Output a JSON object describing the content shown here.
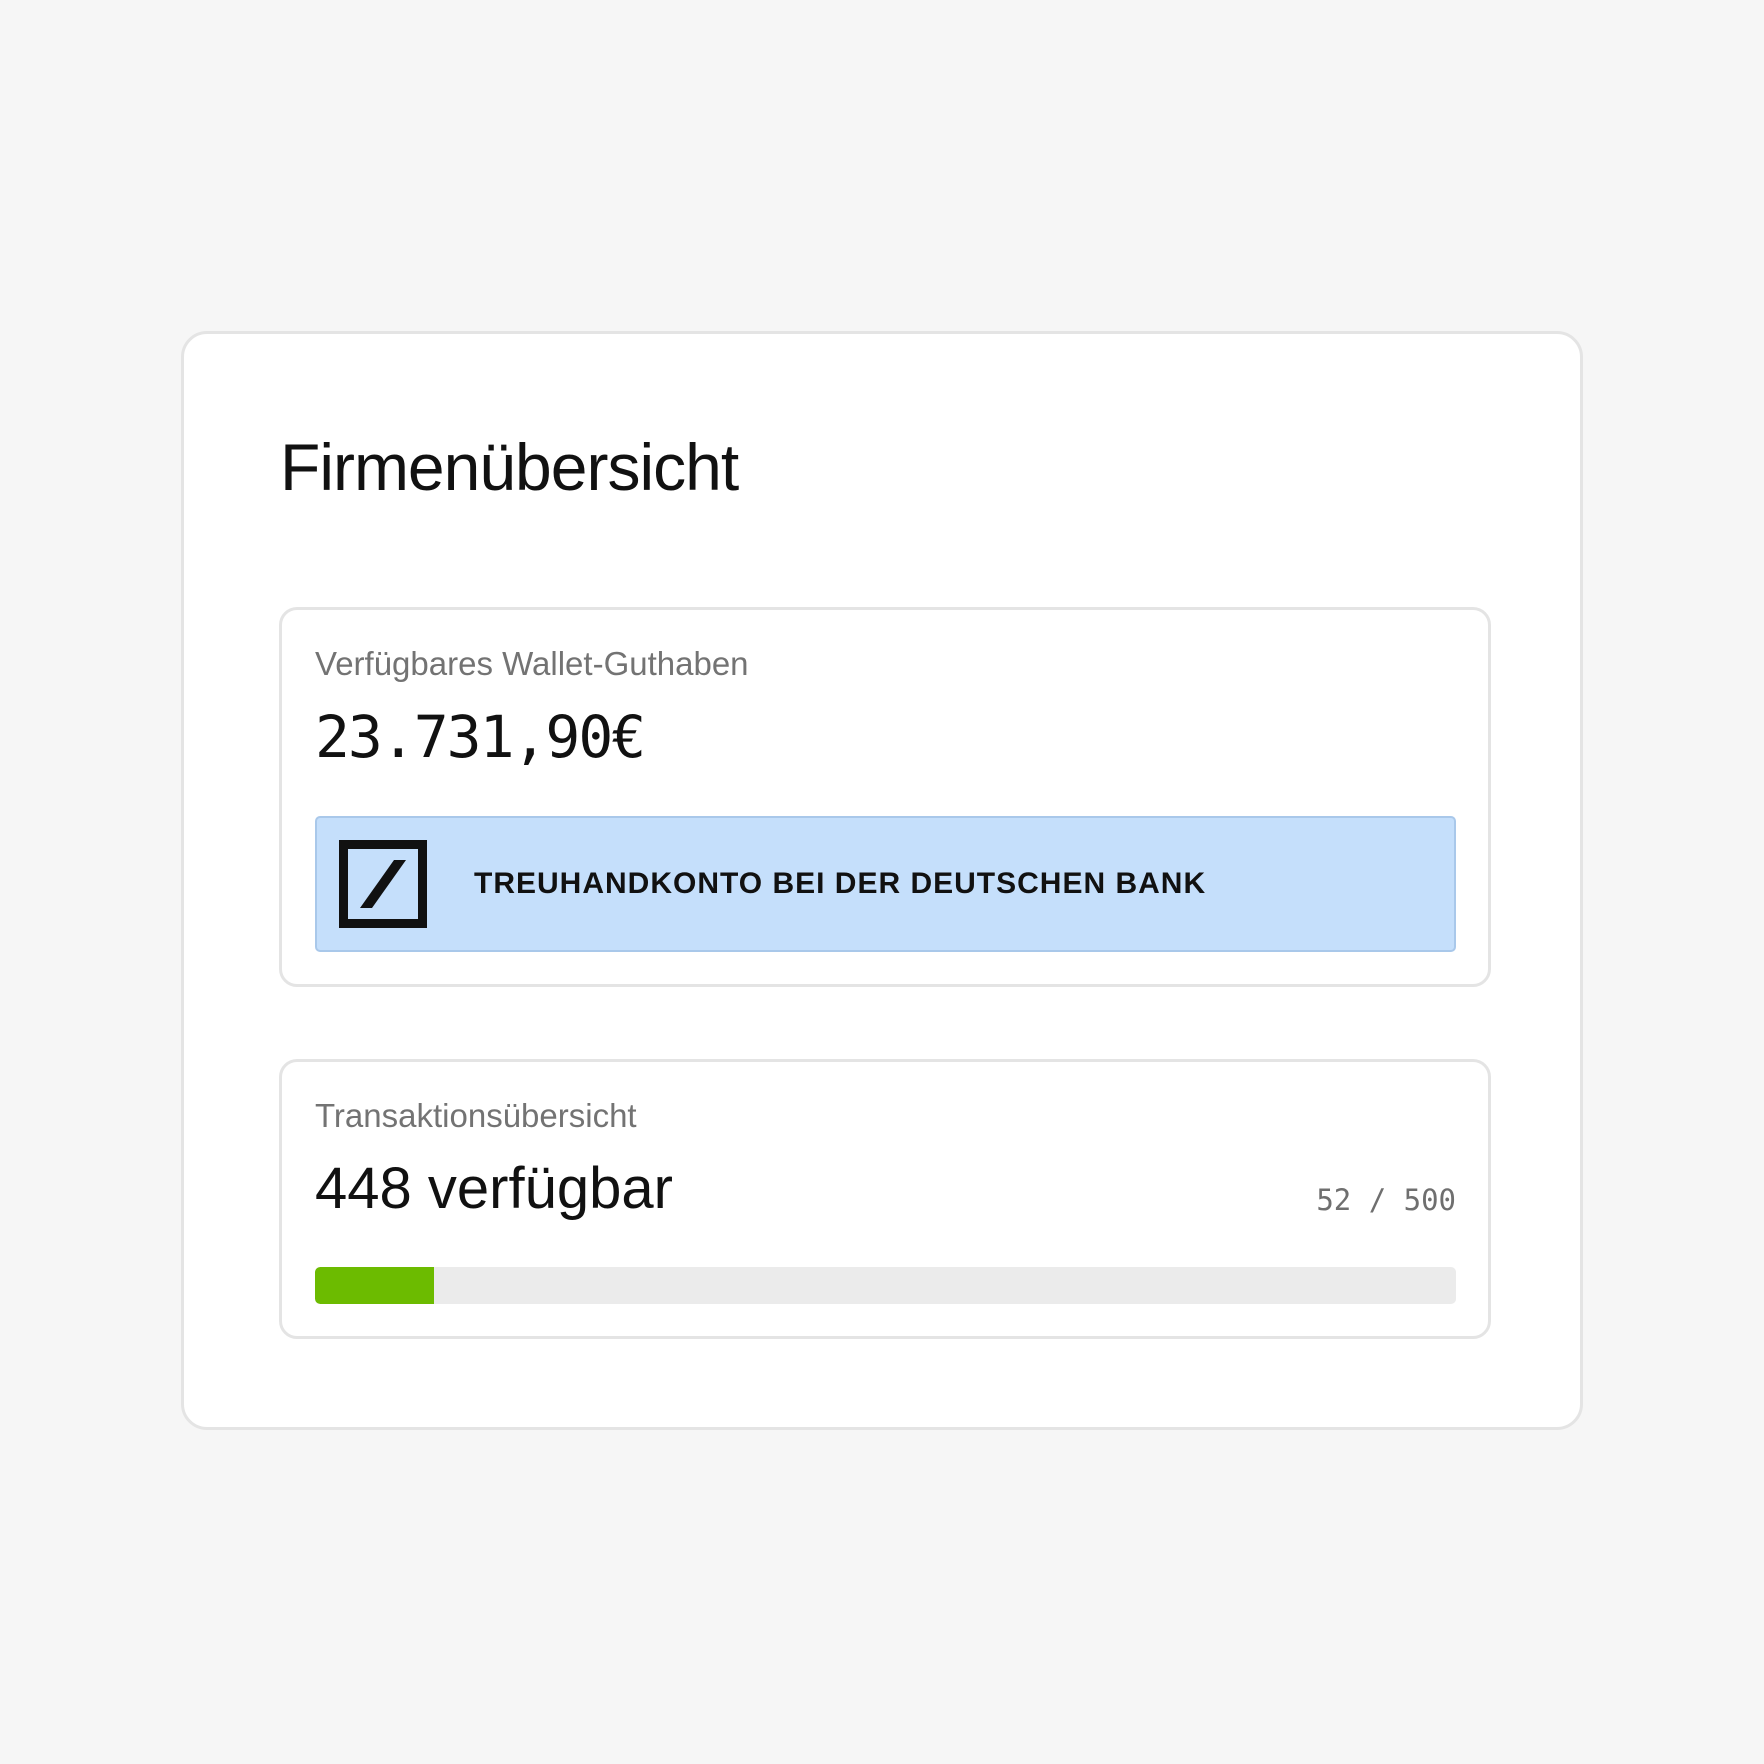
{
  "page": {
    "title": "Firmenübersicht"
  },
  "wallet": {
    "label": "Verfügbares Wallet-Guthaben",
    "balance": "23.731,90€",
    "bank_banner": {
      "text": "TREUHANDKONTO BEI DER DEUTSCHEN BANK",
      "logo_icon": "deutsche-bank-logo"
    }
  },
  "transactions": {
    "label": "Transaktionsübersicht",
    "available": "448 verfügbar",
    "count_text": "52 / 500",
    "progress": {
      "used": 52,
      "total": 500
    }
  },
  "colors": {
    "background": "#f6f6f6",
    "card": "#ffffff",
    "border": "#e4e4e4",
    "banner": "#c5dffb",
    "progress_fill": "#6cbb00",
    "progress_track": "#ebebeb",
    "text_primary": "#111111",
    "text_secondary": "#737373"
  }
}
